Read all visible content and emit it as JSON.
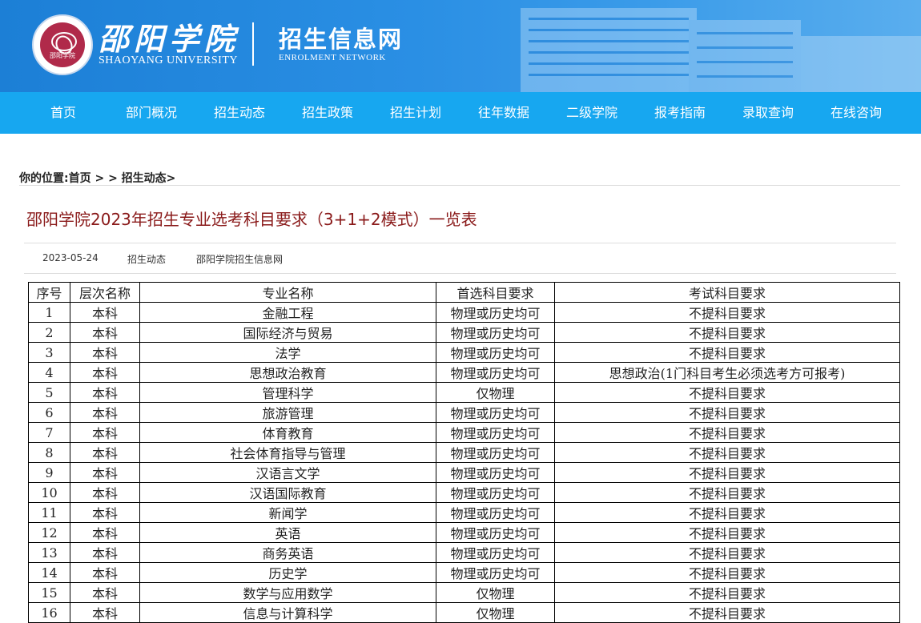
{
  "header": {
    "school_cn": "邵阳学院",
    "school_en": "SHAOYANG UNIVERSITY",
    "logo_text": "邵阳学院",
    "site_cn": "招生信息网",
    "site_en": "ENROLMENT NETWORK"
  },
  "nav": {
    "items": [
      "首页",
      "部门概况",
      "招生动态",
      "招生政策",
      "招生计划",
      "往年数据",
      "二级学院",
      "报考指南",
      "录取查询",
      "在线咨询"
    ]
  },
  "breadcrumb": "你的位置:首页 > > 招生动态>",
  "article": {
    "title": "邵阳学院2023年招生专业选考科目要求（3+1+2模式）一览表",
    "date": "2023-05-24",
    "category": "招生动态",
    "source": "邵阳学院招生信息网"
  },
  "table": {
    "headers": [
      "序号",
      "层次名称",
      "专业名称",
      "首选科目要求",
      "考试科目要求"
    ],
    "rows": [
      [
        "1",
        "本科",
        "金融工程",
        "物理或历史均可",
        "不提科目要求"
      ],
      [
        "2",
        "本科",
        "国际经济与贸易",
        "物理或历史均可",
        "不提科目要求"
      ],
      [
        "3",
        "本科",
        "法学",
        "物理或历史均可",
        "不提科目要求"
      ],
      [
        "4",
        "本科",
        "思想政治教育",
        "物理或历史均可",
        "思想政治(1门科目考生必须选考方可报考)"
      ],
      [
        "5",
        "本科",
        "管理科学",
        "仅物理",
        "不提科目要求"
      ],
      [
        "6",
        "本科",
        "旅游管理",
        "物理或历史均可",
        "不提科目要求"
      ],
      [
        "7",
        "本科",
        "体育教育",
        "物理或历史均可",
        "不提科目要求"
      ],
      [
        "8",
        "本科",
        "社会体育指导与管理",
        "物理或历史均可",
        "不提科目要求"
      ],
      [
        "9",
        "本科",
        "汉语言文学",
        "物理或历史均可",
        "不提科目要求"
      ],
      [
        "10",
        "本科",
        "汉语国际教育",
        "物理或历史均可",
        "不提科目要求"
      ],
      [
        "11",
        "本科",
        "新闻学",
        "物理或历史均可",
        "不提科目要求"
      ],
      [
        "12",
        "本科",
        "英语",
        "物理或历史均可",
        "不提科目要求"
      ],
      [
        "13",
        "本科",
        "商务英语",
        "物理或历史均可",
        "不提科目要求"
      ],
      [
        "14",
        "本科",
        "历史学",
        "物理或历史均可",
        "不提科目要求"
      ],
      [
        "15",
        "本科",
        "数学与应用数学",
        "仅物理",
        "不提科目要求"
      ],
      [
        "16",
        "本科",
        "信息与计算科学",
        "仅物理",
        "不提科目要求"
      ]
    ]
  }
}
